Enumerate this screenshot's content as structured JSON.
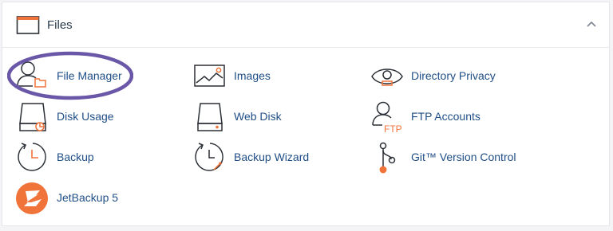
{
  "panel": {
    "title": "Files",
    "header_icon": "folder-icon",
    "collapse_icon": "chevron-up-icon"
  },
  "items": [
    {
      "label": "File Manager",
      "icon": "file-manager-icon"
    },
    {
      "label": "Images",
      "icon": "images-icon"
    },
    {
      "label": "Directory Privacy",
      "icon": "directory-privacy-icon"
    },
    {
      "label": "Disk Usage",
      "icon": "disk-usage-icon"
    },
    {
      "label": "Web Disk",
      "icon": "web-disk-icon"
    },
    {
      "label": "FTP Accounts",
      "icon": "ftp-accounts-icon",
      "icon_text": "FTP"
    },
    {
      "label": "Backup",
      "icon": "backup-icon"
    },
    {
      "label": "Backup Wizard",
      "icon": "backup-wizard-icon"
    },
    {
      "label": "Git™ Version Control",
      "icon": "git-icon"
    },
    {
      "label": "JetBackup 5",
      "icon": "jetbackup-icon"
    }
  ],
  "colors": {
    "accent_orange": "#f0733a",
    "link_blue": "#1f4e87",
    "icon_stroke": "#2b2f36",
    "highlight_purple": "#6b57a8"
  }
}
